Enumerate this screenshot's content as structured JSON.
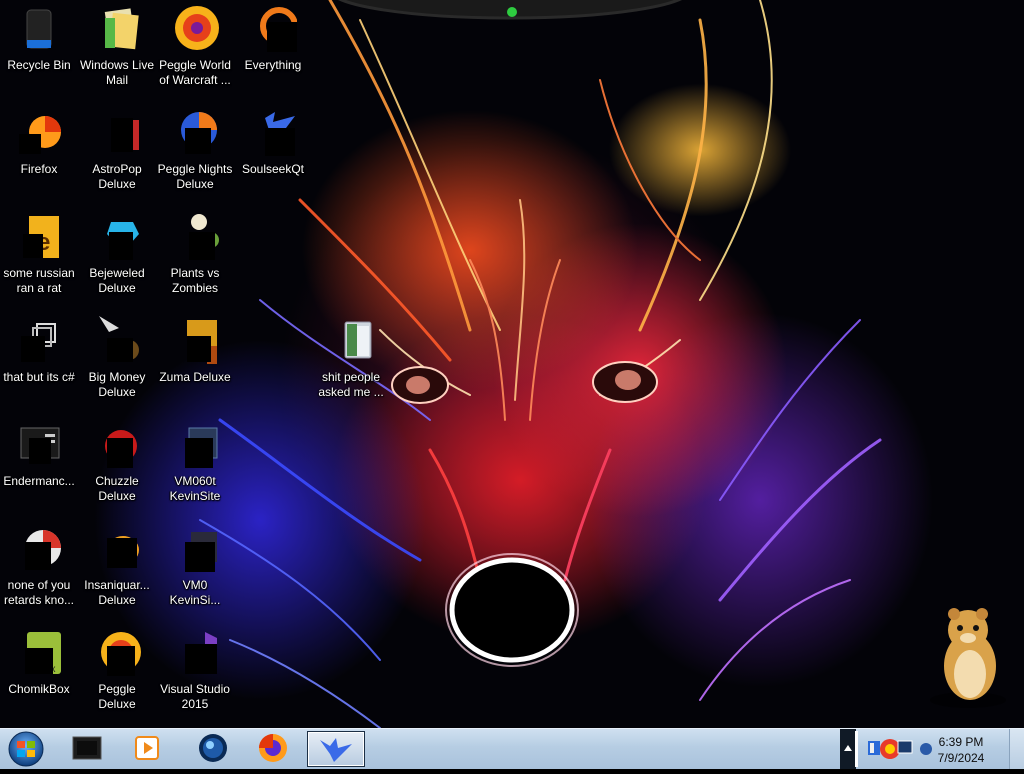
{
  "desktop": {
    "icons": [
      {
        "label": "Recycle Bin"
      },
      {
        "label": "Windows Live Mail"
      },
      {
        "label": "Peggle World of Warcraft ..."
      },
      {
        "label": "Everything"
      },
      {
        "label": "Firefox"
      },
      {
        "label": "AstroPop Deluxe"
      },
      {
        "label": "Peggle Nights Deluxe"
      },
      {
        "label": "SoulseekQt"
      },
      {
        "label": "some russian ran a rat"
      },
      {
        "label": "Bejeweled Deluxe"
      },
      {
        "label": "Plants vs Zombies"
      },
      {
        "label": "that but its c#"
      },
      {
        "label": "Big Money Deluxe"
      },
      {
        "label": "Zuma Deluxe"
      },
      {
        "label": "shit people asked me ..."
      },
      {
        "label": "Endermanc..."
      },
      {
        "label": "Chuzzle Deluxe"
      },
      {
        "label": "VM060t KevinSite"
      },
      {
        "label": "none of you retards kno..."
      },
      {
        "label": "Insaniquar... Deluxe"
      },
      {
        "label": "VM0 KevinSi..."
      },
      {
        "label": "ChomikBox"
      },
      {
        "label": "Peggle Deluxe"
      },
      {
        "label": "Visual Studio 2015"
      }
    ]
  },
  "taskbar": {
    "start_icon": "windows-orb-icon",
    "items": [
      {
        "icon": "terminal-icon"
      },
      {
        "icon": "media-player-icon"
      },
      {
        "icon": "globe-icon"
      },
      {
        "icon": "firefox-icon"
      },
      {
        "icon": "bird-app-icon",
        "active": true
      }
    ],
    "tray_icons": [
      "flag-icon",
      "network-icon",
      "monitor-icon",
      "help-icon"
    ]
  },
  "clock": {
    "time": "6:39 PM",
    "date": "7/9/2024"
  },
  "colors": {
    "taskbar": "#b6cde3",
    "desktop_text": "#ffffff"
  }
}
